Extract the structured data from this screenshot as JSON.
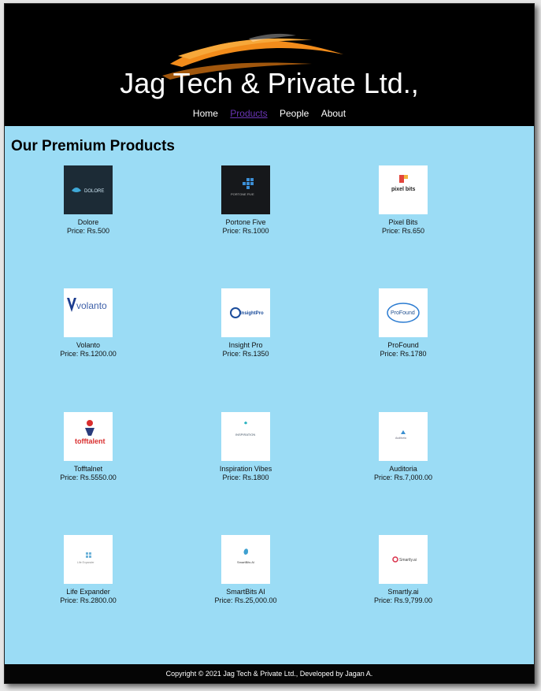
{
  "site": {
    "title": "Jag Tech & Private Ltd.,",
    "accent": "#f28c1b",
    "background": "#9bdcf5"
  },
  "nav": {
    "items": [
      {
        "label": "Home",
        "active": false
      },
      {
        "label": "Products",
        "active": true
      },
      {
        "label": "People",
        "active": false
      },
      {
        "label": "About",
        "active": false
      }
    ]
  },
  "main": {
    "heading": "Our Premium Products",
    "products": [
      {
        "name": "Dolore",
        "price": "Price: Rs.500",
        "logo": "DOLORE"
      },
      {
        "name": "Portone Five",
        "price": "Price: Rs.1000",
        "logo": "PORTONE FIVE"
      },
      {
        "name": "Pixel Bits",
        "price": "Price: Rs.650",
        "logo": "pixel bits"
      },
      {
        "name": "Volanto",
        "price": "Price: Rs.1200.00",
        "logo": "volanto"
      },
      {
        "name": "Insight Pro",
        "price": "Price: Rs.1350",
        "logo": "InsightPro"
      },
      {
        "name": "ProFound",
        "price": "Price: Rs.1780",
        "logo": "ProFound"
      },
      {
        "name": "Tofftalnet",
        "price": "Price: Rs.5550.00",
        "logo": "tofftalent"
      },
      {
        "name": "Inspiration Vibes",
        "price": "Price: Rs.1800",
        "logo": "INSPIRATION"
      },
      {
        "name": "Auditoria",
        "price": "Price: Rs.7,000.00",
        "logo": "Auditoria"
      },
      {
        "name": "Life Expander",
        "price": "Price: Rs.2800.00",
        "logo": "Life Expander"
      },
      {
        "name": "SmartBits AI",
        "price": "Price: Rs.25,000.00",
        "logo": "SmartBits AI"
      },
      {
        "name": "Smartly.ai",
        "price": "Price: Rs.9,799.00",
        "logo": "Smartly.ai"
      }
    ]
  },
  "footer": {
    "text": "Copyright © 2021 Jag Tech & Private Ltd., Developed by Jagan A."
  }
}
